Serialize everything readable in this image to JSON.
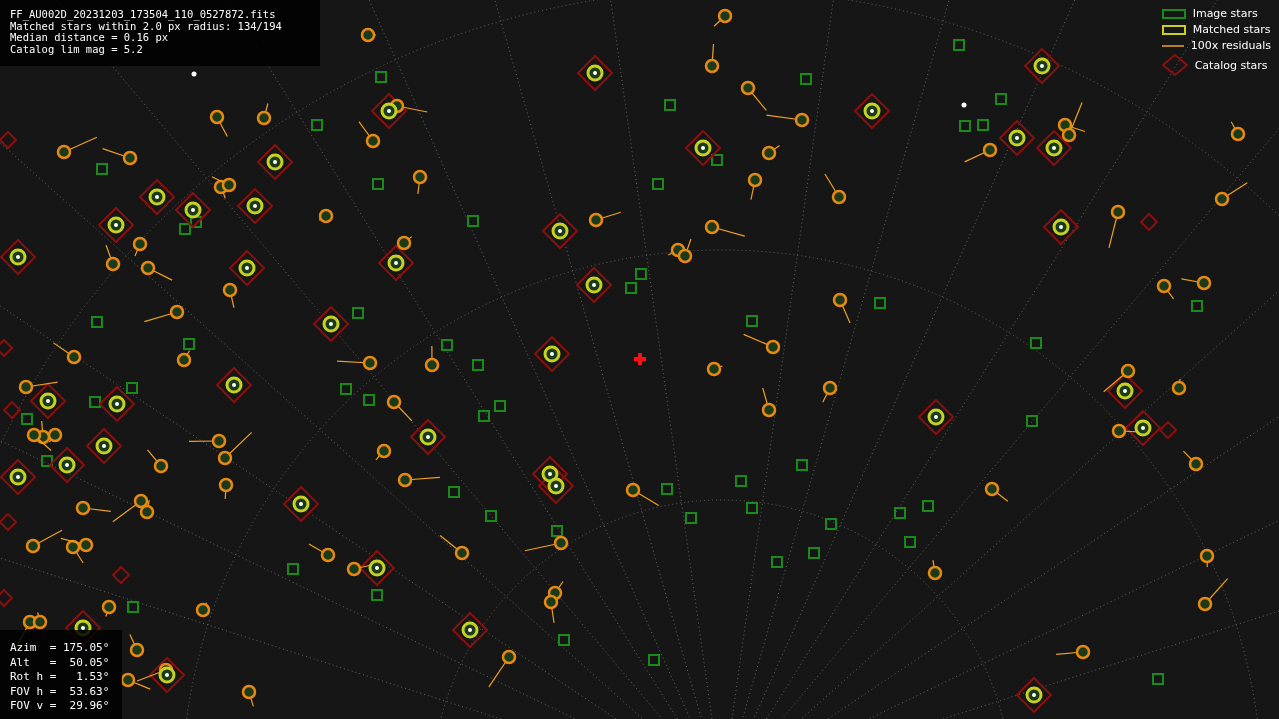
{
  "info_lines": [
    "FF_AU002D_20231203_173504_110_0527872.fits",
    "Matched stars within 2.0 px radius: 134/194",
    "Median distance = 0.16 px",
    "Catalog lim mag = 5.2"
  ],
  "legend": [
    {
      "kind": "image",
      "label": "Image stars"
    },
    {
      "kind": "matched",
      "label": "Matched stars"
    },
    {
      "kind": "residual",
      "label": "100x residuals"
    },
    {
      "kind": "catalog",
      "label": "Catalog stars"
    }
  ],
  "pointing": [
    "Azim  = 175.05°",
    "Alt   =  50.05°",
    "Rot h =   1.53°",
    "FOV h =  53.63°",
    "FOV v =  29.96°"
  ]
}
